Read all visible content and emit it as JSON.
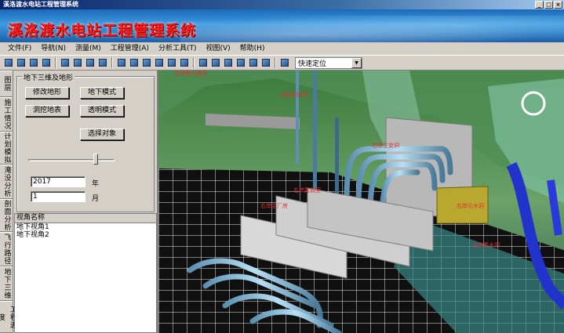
{
  "window": {
    "title": "溪洛渡水电站工程管理系统"
  },
  "banner": {
    "title": "溪洛渡水电站工程管理系统"
  },
  "menu": [
    {
      "label": "文件(F)"
    },
    {
      "label": "导航(N)"
    },
    {
      "label": "测量(M)"
    },
    {
      "label": "工程管理(A)"
    },
    {
      "label": "分析工具(T)"
    },
    {
      "label": "视图(V)"
    },
    {
      "label": "帮助(H)"
    }
  ],
  "toolbar": {
    "quick_locate": "快速定位"
  },
  "side_tabs": [
    {
      "label": "图层"
    },
    {
      "label": "施工情况"
    },
    {
      "label": "计划模拟"
    },
    {
      "label": "淹没分析"
    },
    {
      "label": "剖面分析"
    },
    {
      "label": "飞行路径"
    },
    {
      "label": "地下三维"
    },
    {
      "label": "工程进度"
    }
  ],
  "panel": {
    "group_title": "地下三维及地形",
    "modify_terrain": "修改地形",
    "underground_mode": "地下模式",
    "dig_terrain": "洞挖地表",
    "transparent_mode": "透明模式",
    "select_object": "选择对象",
    "year_value": "2017",
    "year_label": "年",
    "month_value": "1",
    "month_label": "月",
    "slider_fraction": 0.78,
    "list_header": "视角名称",
    "list_items": [
      "地下视角1",
      "地下视角2"
    ]
  },
  "viewport": {
    "labels": [
      "右岸出线洞",
      "右岸主变洞",
      "右岸尾调室",
      "右岸主厂房",
      "右岸引水洞",
      "右岸尾水洞",
      "右岸尾水隧洞"
    ]
  }
}
